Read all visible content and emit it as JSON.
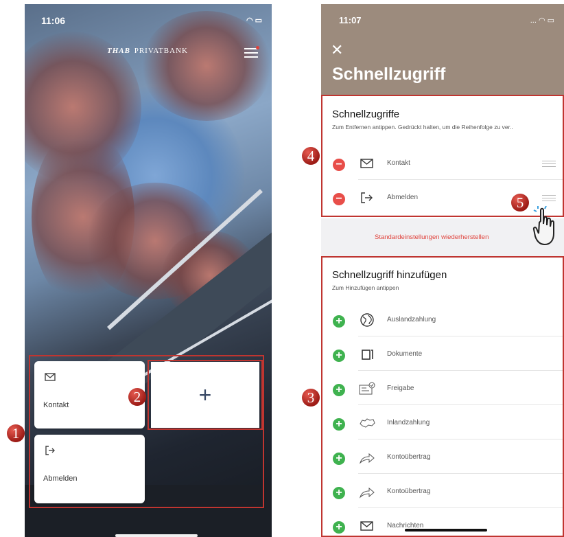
{
  "left_screen": {
    "status_time": "11:06",
    "brand": "PRIVATBANK",
    "brand_mark": "THAB",
    "tiles": [
      {
        "icon": "mail-icon",
        "label": "Kontakt"
      },
      {
        "icon": "logout-icon",
        "label": "Abmelden"
      }
    ],
    "add_symbol": "+"
  },
  "right_screen": {
    "status_time": "11:07",
    "close_symbol": "✕",
    "title": "Schnellzugriff",
    "current": {
      "title": "Schnellzugriffe",
      "subtitle": "Zum Entfernen antippen. Gedrückt halten, um die Reihenfolge zu ver..",
      "items": [
        {
          "icon": "mail-icon",
          "label": "Kontakt"
        },
        {
          "icon": "logout-icon",
          "label": "Abmelden"
        }
      ]
    },
    "restore_label": "Standardeinstellungen wiederherstellen",
    "add": {
      "title": "Schnellzugriff hinzufügen",
      "subtitle": "Zum Hinzufügen antippen",
      "items": [
        {
          "icon": "globe-icon",
          "label": "Auslandzahlung"
        },
        {
          "icon": "documents-icon",
          "label": "Dokumente"
        },
        {
          "icon": "approval-icon",
          "label": "Freigabe"
        },
        {
          "icon": "switzerland-icon",
          "label": "Inlandzahlung"
        },
        {
          "icon": "arrow-right-icon",
          "label": "Kontoübertrag"
        },
        {
          "icon": "arrow-right-icon",
          "label": "Kontoübertrag"
        },
        {
          "icon": "mail-icon",
          "label": "Nachrichten"
        }
      ]
    }
  },
  "annotations": [
    "1",
    "2",
    "3",
    "4",
    "5"
  ],
  "colors": {
    "header": "#9c8b7d",
    "remove": "#e84e49",
    "add": "#3fb24f",
    "highlight": "#c03530",
    "link": "#e0433c"
  }
}
